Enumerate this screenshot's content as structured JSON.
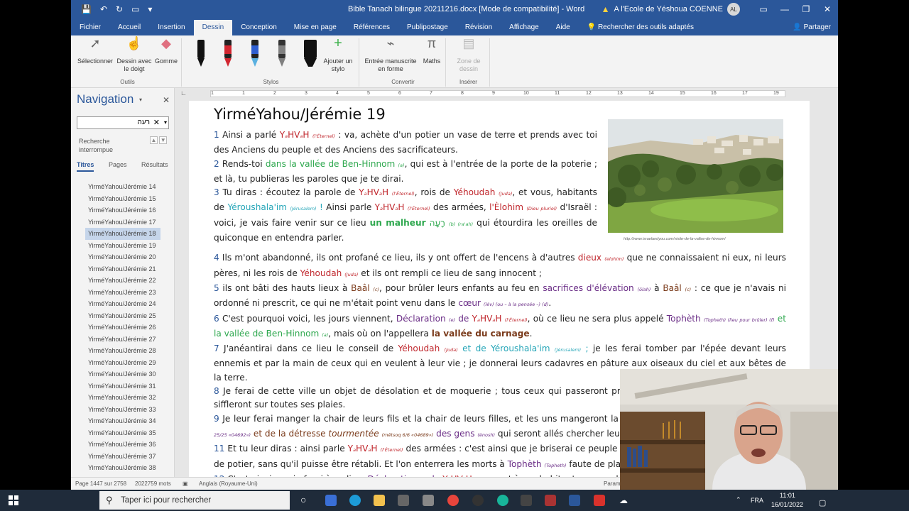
{
  "window": {
    "title": "Bible Tanach bilingue 20211216.docx [Mode de compatibilité] - Word",
    "user": "A l'Ecole de Yéshoua COENNE",
    "user_initials": "AL"
  },
  "ribbon_tabs": [
    "Fichier",
    "Accueil",
    "Insertion",
    "Dessin",
    "Conception",
    "Mise en page",
    "Références",
    "Publipostage",
    "Révision",
    "Affichage",
    "Aide"
  ],
  "ribbon_search": "Rechercher des outils adaptés",
  "share_label": "Partager",
  "ribbon": {
    "outils": {
      "label": "Outils",
      "select": "Sélectionner",
      "draw_finger": "Dessin avec le doigt",
      "eraser": "Gomme"
    },
    "stylos": {
      "label": "Stylos",
      "add_pen": "Ajouter un stylo"
    },
    "convertir": {
      "label": "Convertir",
      "ink_to_shape": "Entrée manuscrite en forme",
      "math": "Maths"
    },
    "inserer": {
      "label": "Insérer",
      "drawing_zone": "Zone de dessin"
    }
  },
  "pen_colors": [
    "#111111",
    "#d22630",
    "#2f5fd0",
    "#808080",
    "#111111"
  ],
  "navigation": {
    "title": "Navigation",
    "search_value": "רעה",
    "status": "Recherche interrompue",
    "tabs": [
      "Titres",
      "Pages",
      "Résultats"
    ],
    "items": [
      "YirméYahou/Jérémie 14",
      "YirméYahou/Jérémie 15",
      "YirméYahou/Jérémie 16",
      "YirméYahou/Jérémie 17",
      "YirméYahou/Jérémie 18",
      "YirméYahou/Jérémie 19",
      "YirméYahou/Jérémie 20",
      "YirméYahou/Jérémie 21",
      "YirméYahou/Jérémie 22",
      "YirméYahou/Jérémie 23",
      "YirméYahou/Jérémie 24",
      "YirméYahou/Jérémie 25",
      "YirméYahou/Jérémie 26",
      "YirméYahou/Jérémie 27",
      "YirméYahou/Jérémie 28",
      "YirméYahou/Jérémie 29",
      "YirméYahou/Jérémie 30",
      "YirméYahou/Jérémie 31",
      "YirméYahou/Jérémie 32",
      "YirméYahou/Jérémie 33",
      "YirméYahou/Jérémie 34",
      "YirméYahou/Jérémie 35",
      "YirméYahou/Jérémie 36",
      "YirméYahou/Jérémie 37",
      "YirméYahou/Jérémie 38"
    ],
    "selected_index": 4
  },
  "ruler_numbers": [
    "1",
    "1",
    "2",
    "3",
    "4",
    "5",
    "6",
    "7",
    "8",
    "9",
    "10",
    "11",
    "12",
    "13",
    "14",
    "15",
    "16",
    "17",
    "19"
  ],
  "document": {
    "heading": "YirméYahou/Jérémie 19",
    "photo_caption": "http://www.israelandyou.com/visite-de-la-vallee-de-hinnom/"
  },
  "statusbar": {
    "page": "Page 1447 sur 2758",
    "words": "2022759 mots",
    "language": "Anglais (Royaume-Uni)",
    "param": "Param"
  },
  "taskbar": {
    "search_placeholder": "Taper ici pour rechercher",
    "lang": "FRA",
    "time": "11:01",
    "date": "16/01/2022"
  }
}
